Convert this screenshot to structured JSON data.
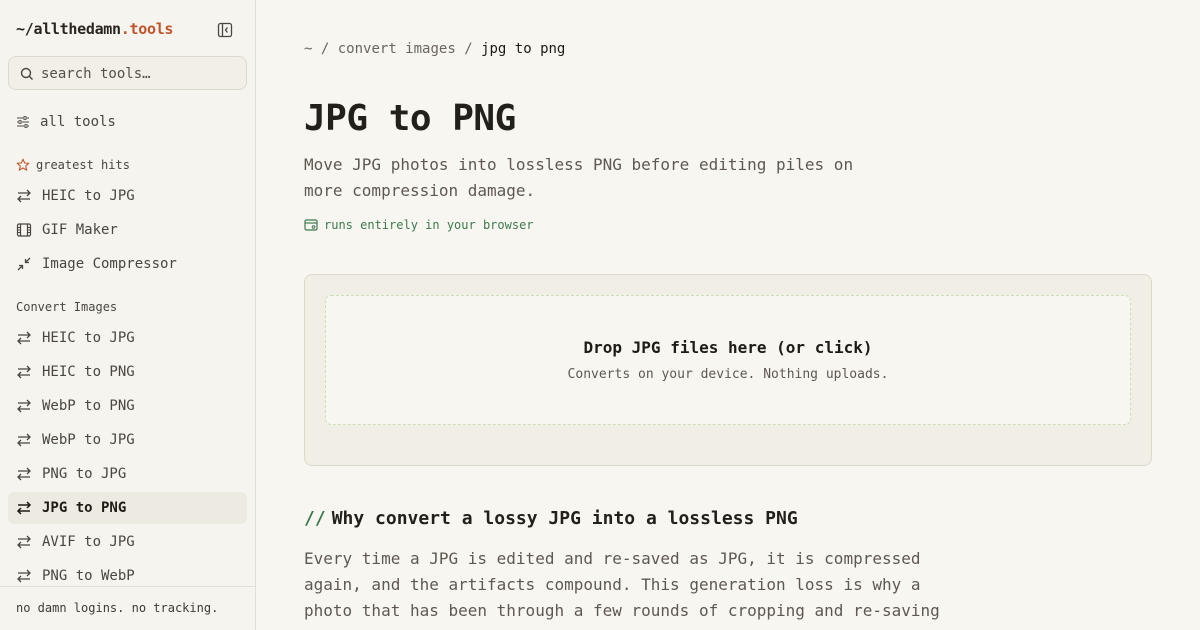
{
  "sidebar": {
    "brand_prefix": "~/allthedamn",
    "brand_tld": ".tools",
    "search_placeholder": "search tools…",
    "all_tools_label": "all tools",
    "greatest_hits_label": "greatest hits",
    "greatest_hits": [
      {
        "label": "HEIC to JPG",
        "icon": "arrows-swap-icon"
      },
      {
        "label": "GIF Maker",
        "icon": "film-icon"
      },
      {
        "label": "Image Compressor",
        "icon": "compress-icon"
      }
    ],
    "convert_images_label": "Convert Images",
    "convert_images": [
      {
        "label": "HEIC to JPG",
        "active": false
      },
      {
        "label": "HEIC to PNG",
        "active": false
      },
      {
        "label": "WebP to PNG",
        "active": false
      },
      {
        "label": "WebP to JPG",
        "active": false
      },
      {
        "label": "PNG to JPG",
        "active": false
      },
      {
        "label": "JPG to PNG",
        "active": true
      },
      {
        "label": "AVIF to JPG",
        "active": false
      },
      {
        "label": "PNG to WebP",
        "active": false
      }
    ],
    "footer": "no damn logins. no tracking."
  },
  "breadcrumb": {
    "home": "~",
    "sep": "/",
    "section": "convert images",
    "current": "jpg to png"
  },
  "page": {
    "title": "JPG to PNG",
    "subtitle": "Move JPG photos into lossless PNG before editing piles on more compression damage.",
    "badge": "runs entirely in your browser"
  },
  "dropzone": {
    "title": "Drop JPG files here (or click)",
    "subtitle": "Converts on your device. Nothing uploads."
  },
  "section": {
    "slashes": "//",
    "heading": "Why convert a lossy JPG into a lossless PNG",
    "body": "Every time a JPG is edited and re-saved as JPG, it is compressed again, and the artifacts compound. This generation loss is why a photo that has been through a few rounds of cropping and re-saving"
  },
  "colors": {
    "accent": "#c0552c",
    "green": "#3c7a4e",
    "background": "#f8f6f1"
  }
}
